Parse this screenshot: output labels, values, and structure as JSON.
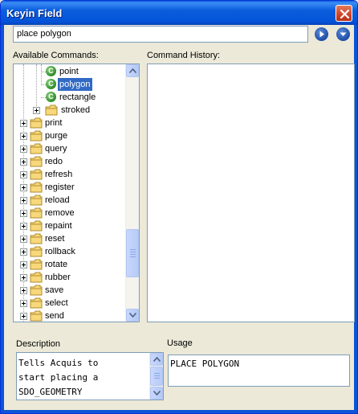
{
  "window": {
    "title": "Keyin Field",
    "close_label": "close"
  },
  "keyin": {
    "value": "place polygon"
  },
  "labels": {
    "available_commands": "Available Commands:",
    "command_history": "Command History:",
    "description": "Description",
    "usage": "Usage"
  },
  "tree": {
    "leaf_items": [
      {
        "label": "point",
        "icon": "command-icon"
      },
      {
        "label": "polygon",
        "icon": "command-icon",
        "selected": true
      },
      {
        "label": "rectangle",
        "icon": "command-icon"
      }
    ],
    "sub_folder": {
      "label": "stroked",
      "icon": "folder-icon"
    },
    "folders": [
      {
        "label": "print"
      },
      {
        "label": "purge"
      },
      {
        "label": "query"
      },
      {
        "label": "redo"
      },
      {
        "label": "refresh"
      },
      {
        "label": "register"
      },
      {
        "label": "reload"
      },
      {
        "label": "remove"
      },
      {
        "label": "repaint"
      },
      {
        "label": "reset"
      },
      {
        "label": "rollback"
      },
      {
        "label": "rotate"
      },
      {
        "label": "rubber"
      },
      {
        "label": "save"
      },
      {
        "label": "select"
      },
      {
        "label": "send"
      }
    ],
    "command_icon_letter": "C"
  },
  "description": {
    "text": "Tells Acquis to\nstart placing a\nSDO_GEOMETRY"
  },
  "usage": {
    "text": "PLACE POLYGON"
  }
}
